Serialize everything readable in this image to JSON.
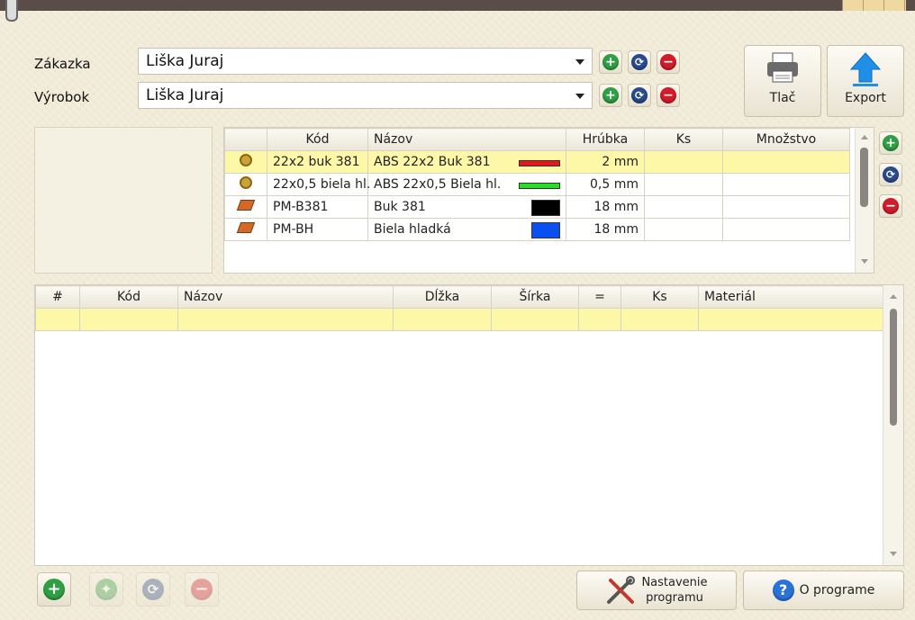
{
  "colors": {
    "accent": "#2ea043",
    "selected_row": "#fdf7a8"
  },
  "form": {
    "zakazka_label": "Zákazka",
    "zakazka_value": "Liška Juraj",
    "vyrobok_label": "Výrobok",
    "vyrobok_value": "Liška Juraj"
  },
  "toolbar": {
    "print_label": "Tlač",
    "export_label": "Export"
  },
  "materials": {
    "headers": [
      "Kód",
      "Názov",
      "Hrúbka",
      "Ks",
      "Množstvo"
    ],
    "rows": [
      {
        "icon": "edge-band-icon",
        "code": "22x2 buk 381",
        "name": "ABS 22x2 Buk 381",
        "swatch": "#e8141c",
        "thickness": "2 mm",
        "ks": "",
        "qty": ""
      },
      {
        "icon": "edge-band-icon",
        "code": "22x0,5 biela hl.",
        "name": "ABS 22x0,5 Biela hl.",
        "swatch": "#22e022",
        "thickness": "0,5 mm",
        "ks": "",
        "qty": ""
      },
      {
        "icon": "board-icon",
        "code": "PM-B381",
        "name": "Buk 381",
        "swatch": "#000000",
        "thickness": "18 mm",
        "ks": "",
        "qty": ""
      },
      {
        "icon": "board-icon",
        "code": "PM-BH",
        "name": "Biela hladká",
        "swatch": "#0a4ff0",
        "thickness": "18 mm",
        "ks": "",
        "qty": ""
      }
    ]
  },
  "parts": {
    "headers": [
      "#",
      "Kód",
      "Názov",
      "Dĺžka",
      "Šírka",
      "=",
      "Ks",
      "Materiál"
    ]
  },
  "bottom": {
    "settings_label_1": "Nastavenie",
    "settings_label_2": "programu",
    "about_label": "O programe"
  }
}
